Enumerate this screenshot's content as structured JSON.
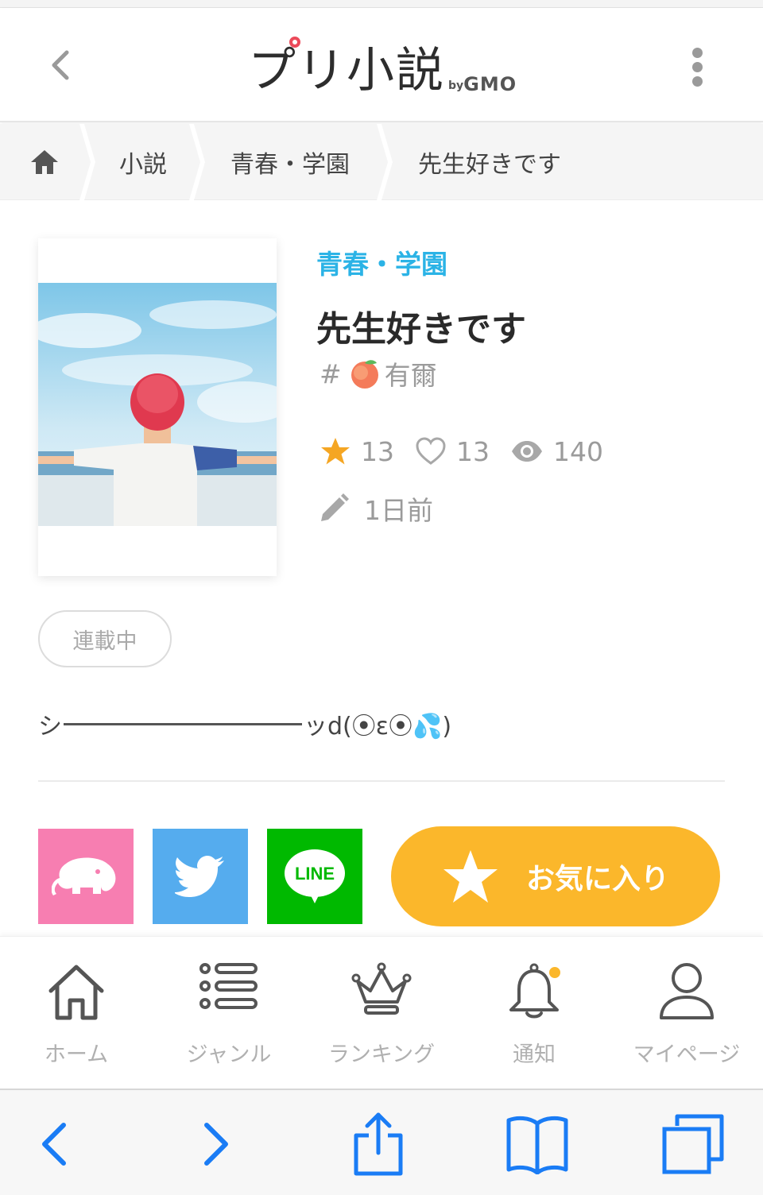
{
  "header": {
    "logo_main": "プリ小説",
    "logo_by": "by",
    "logo_gmo": "GMO"
  },
  "breadcrumb": {
    "items": [
      {
        "label": "小説"
      },
      {
        "label": "青春・学園"
      },
      {
        "label": "先生好きです"
      }
    ]
  },
  "book": {
    "genre": "青春・学園",
    "title": "先生好きです",
    "author_prefix": "#",
    "author_name": "有爾",
    "stars": "13",
    "likes": "13",
    "views": "140",
    "updated": "1日前",
    "status": "連載中",
    "desc_start": "シ",
    "desc_end": "ッd(⦿ε⦿💦)"
  },
  "share": {
    "line_label": "LINE",
    "favorite_label": "お気に入り"
  },
  "tabbar": {
    "tabs": [
      {
        "label": "ホーム"
      },
      {
        "label": "ジャンル"
      },
      {
        "label": "ランキング"
      },
      {
        "label": "通知"
      },
      {
        "label": "マイページ"
      }
    ]
  },
  "colors": {
    "accent_blue": "#2bb3e6",
    "favorite_orange": "#fbb72b",
    "star": "#f5a623",
    "safari_blue": "#1a7cf5"
  }
}
